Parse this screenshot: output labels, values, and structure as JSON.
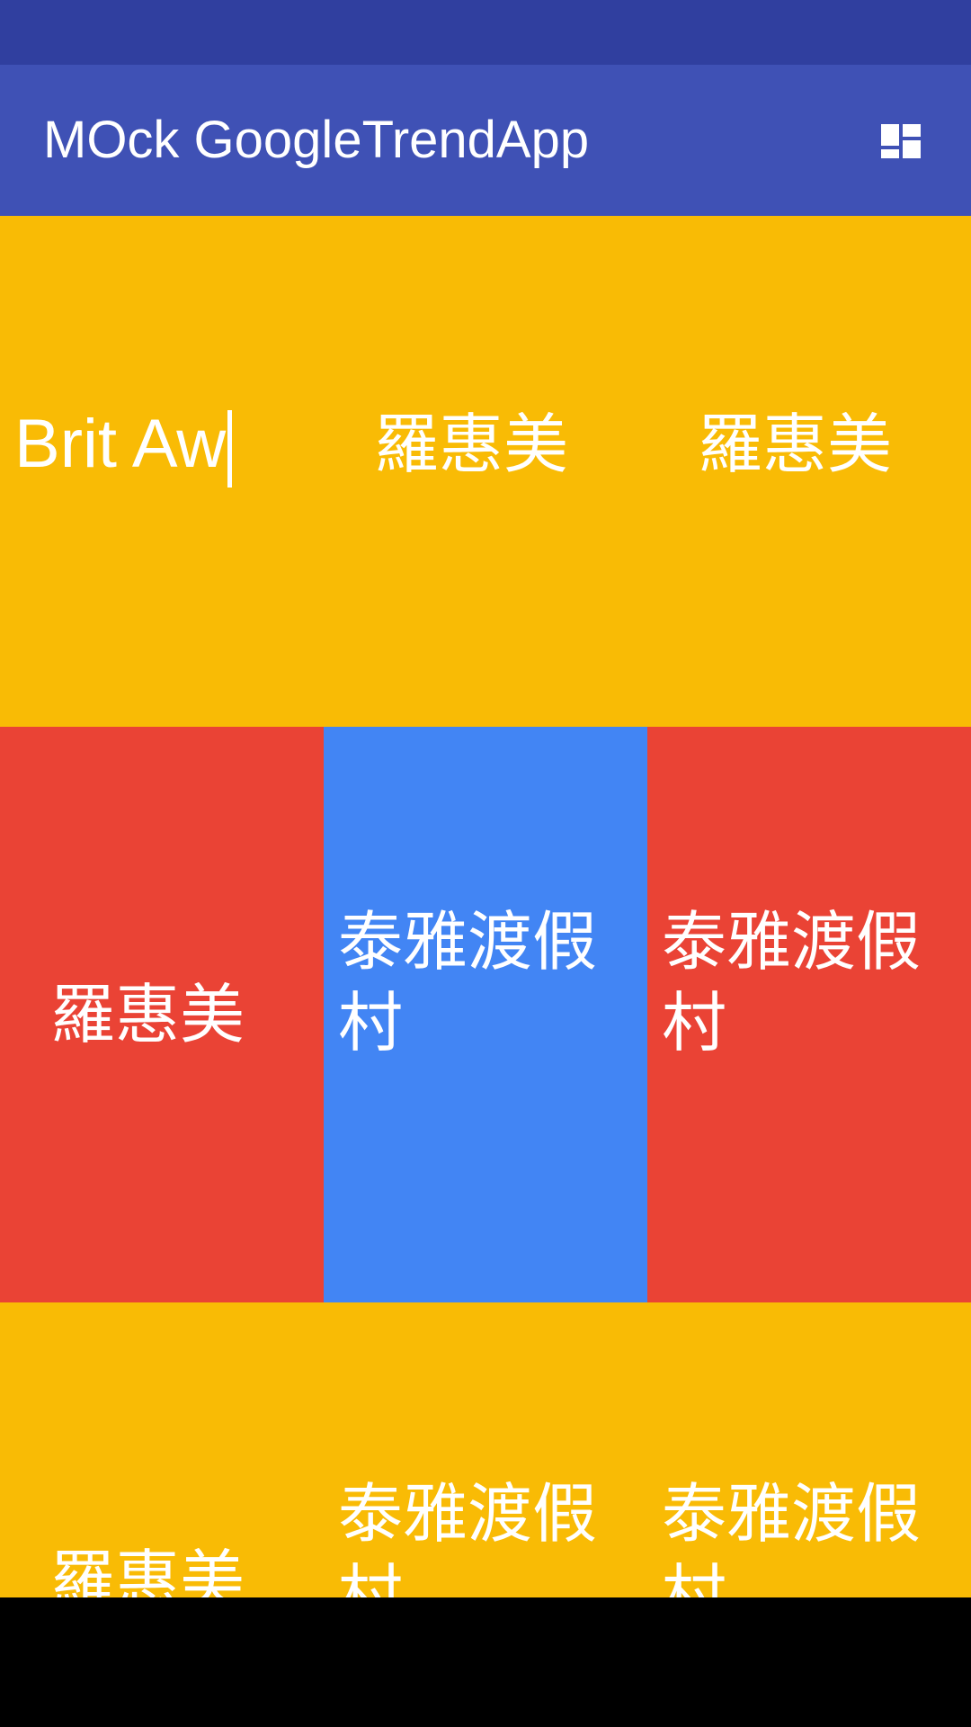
{
  "colors": {
    "status_bar": "#303f9f",
    "app_bar": "#3f51b5",
    "yellow": "#f9bb05",
    "red": "#ea4335",
    "blue": "#4285f4",
    "nav_bar": "#000000"
  },
  "app_bar": {
    "title": "MOck GoogleTrendApp",
    "grid_toggle_icon": "dashboard-grid-icon"
  },
  "grid": {
    "rows": [
      {
        "cells": [
          {
            "text": "Brit Aw",
            "color": "yellow",
            "typing": true
          },
          {
            "text": "羅惠美",
            "color": "yellow"
          },
          {
            "text": "羅惠美",
            "color": "yellow"
          }
        ]
      },
      {
        "cells": [
          {
            "text": "羅惠美",
            "color": "red"
          },
          {
            "text": "泰雅渡假村",
            "color": "blue"
          },
          {
            "text": "泰雅渡假村",
            "color": "red"
          }
        ]
      },
      {
        "cells": [
          {
            "text": "羅惠美",
            "color": "yellow"
          },
          {
            "text": "泰雅渡假村",
            "color": "yellow"
          },
          {
            "text": "泰雅渡假村",
            "color": "yellow"
          }
        ]
      }
    ]
  }
}
